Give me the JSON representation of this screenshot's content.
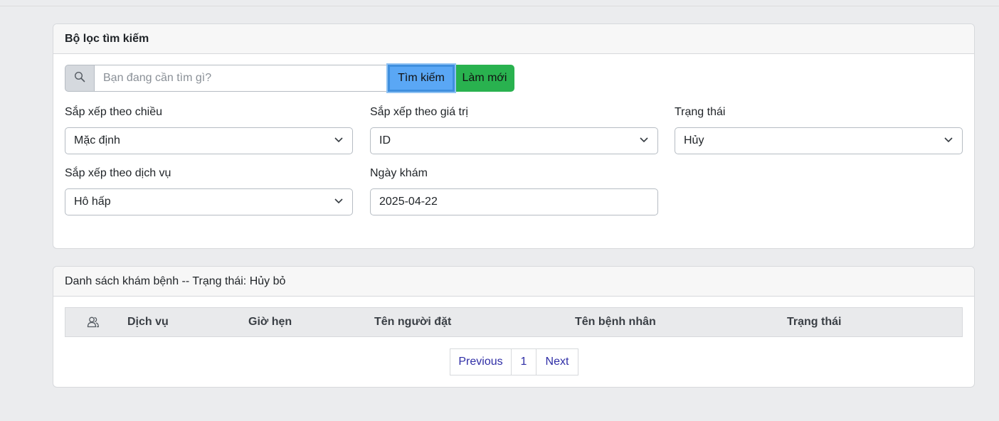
{
  "filter": {
    "title": "Bộ lọc tìm kiếm",
    "search": {
      "placeholder": "Bạn đang cần tìm gì?",
      "value": ""
    },
    "search_button": "Tìm kiếm",
    "refresh_button": "Làm mới",
    "fields": [
      {
        "label": "Sắp xếp theo chiều",
        "value": "Mặc định"
      },
      {
        "label": "Sắp xếp theo giá trị",
        "value": "ID"
      },
      {
        "label": "Trạng thái",
        "value": "Hủy"
      },
      {
        "label": "Sắp xếp theo dịch vụ",
        "value": "Hô hấp"
      },
      {
        "label": "Ngày khám",
        "value": "2025-04-22"
      }
    ]
  },
  "list": {
    "title": "Danh sách khám bệnh -- Trạng thái: Hủy bỏ",
    "columns": [
      "Dịch vụ",
      "Giờ hẹn",
      "Tên người đặt",
      "Tên bệnh nhân",
      "Trạng thái"
    ],
    "header_icon": "users-icon",
    "rows": []
  },
  "pagination": {
    "previous": "Previous",
    "current": "1",
    "next": "Next"
  },
  "colors": {
    "primary": "#5aa7f5",
    "success": "#29b24f",
    "link": "#2f2ea6"
  }
}
